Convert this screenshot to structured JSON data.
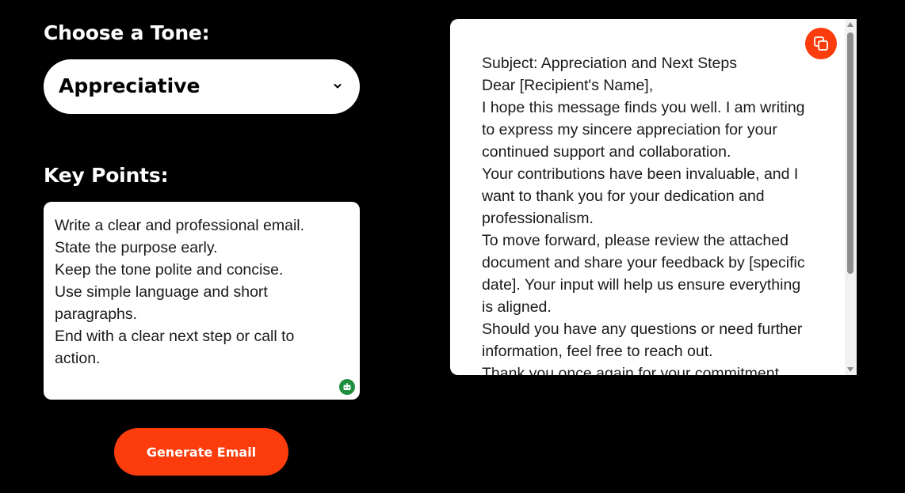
{
  "tone": {
    "heading": "Choose a Tone:",
    "selected": "Appreciative"
  },
  "key_points": {
    "heading": "Key Points:",
    "lines": [
      "Write a clear and professional email.",
      "State the purpose early.",
      "Keep the tone polite and concise.",
      "Use simple language and short",
      "paragraphs.",
      "End with a clear next step or call to",
      "action."
    ]
  },
  "generate_button": {
    "label": "Generate Email"
  },
  "output": {
    "lines": [
      "Subject: Appreciation and Next Steps",
      "Dear [Recipient's Name],",
      "I hope this message finds you well. I am writing",
      "to express my sincere appreciation for your",
      "continued support and collaboration.",
      "Your contributions have been invaluable, and I",
      "want to thank you for your dedication and",
      "professionalism.",
      "To move forward, please review the attached",
      "document and share your feedback by [specific",
      "date]. Your input will help us ensure everything",
      "is aligned.",
      "Should you have any questions or need further",
      "information, feel free to reach out.",
      "Thank you once again for your commitment."
    ],
    "copy_icon": "copy-icon"
  },
  "colors": {
    "background": "#000000",
    "accent": "#fc3c0c",
    "panel": "#ffffff",
    "assistant_icon": "#1e8e3e"
  }
}
